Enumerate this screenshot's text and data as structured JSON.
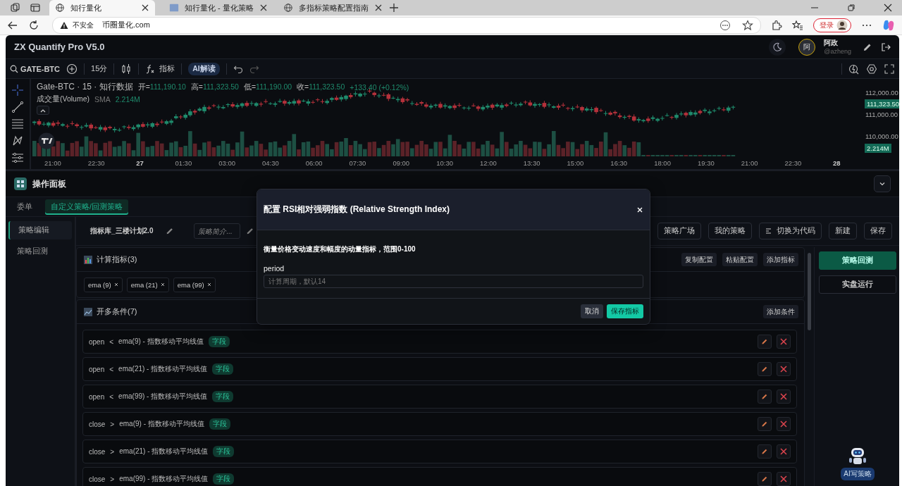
{
  "browser": {
    "tabs": [
      {
        "title": "知行量化",
        "selected": true
      },
      {
        "title": "知行量化 - 量化策略",
        "selected": false
      },
      {
        "title": "多指标策略配置指南",
        "selected": false
      }
    ],
    "security": "不安全",
    "url": "币圈量化.com",
    "login": "登录"
  },
  "app": {
    "title": "ZX Quantify Pro V5.0",
    "user": {
      "avatar": "阿",
      "name": "阿政",
      "handle": "@azheng"
    }
  },
  "toolbar": {
    "symbol": "GATE-BTC",
    "interval": "15分",
    "indicators": "指标",
    "ai": "AI解读"
  },
  "chart": {
    "legend": "Gate-BTC · 15 · 知行数据",
    "ohlc": [
      {
        "label": "开=",
        "value": "111,190.10"
      },
      {
        "label": "高=",
        "value": "111,323.50"
      },
      {
        "label": "低=",
        "value": "111,190.00"
      },
      {
        "label": "收=",
        "value": "111,323.50"
      }
    ],
    "change": "+133.40 (+0.12%)",
    "volume": {
      "label": "成交量(Volume)",
      "ma": "SMA",
      "value": "2.214M"
    },
    "price_axis": [
      "112,000.00",
      "111,000.00",
      "110,000.00"
    ],
    "last_price": "111,323.50",
    "last_volume": "2.214M",
    "time_axis": [
      {
        "label": "21:00",
        "bold": false
      },
      {
        "label": "22:30",
        "bold": false
      },
      {
        "label": "27",
        "bold": true
      },
      {
        "label": "01:30",
        "bold": false
      },
      {
        "label": "03:00",
        "bold": false
      },
      {
        "label": "04:30",
        "bold": false
      },
      {
        "label": "06:00",
        "bold": false
      },
      {
        "label": "07:30",
        "bold": false
      },
      {
        "label": "09:00",
        "bold": false
      },
      {
        "label": "10:30",
        "bold": false
      },
      {
        "label": "12:00",
        "bold": false
      },
      {
        "label": "13:30",
        "bold": false
      },
      {
        "label": "15:00",
        "bold": false
      },
      {
        "label": "16:30",
        "bold": false
      },
      {
        "label": "18:00",
        "bold": false
      },
      {
        "label": "19:30",
        "bold": false
      },
      {
        "label": "21:00",
        "bold": false
      },
      {
        "label": "22:30",
        "bold": false
      },
      {
        "label": "28",
        "bold": true
      }
    ]
  },
  "panel": {
    "title": "操作面板",
    "tabs": [
      {
        "label": "委单",
        "selected": false
      },
      {
        "label": "自定义策略/回测策略",
        "selected": true
      }
    ],
    "nav": [
      {
        "label": "策略编辑",
        "selected": true
      },
      {
        "label": "策略回测",
        "selected": false
      }
    ],
    "strategy_name": "指标库_三楼计划2.0",
    "summary_placeholder": "策略简介...",
    "actions": [
      {
        "label": "策略广场",
        "icon": false
      },
      {
        "label": "我的策略",
        "icon": false
      },
      {
        "label": "切换为代码",
        "icon": true
      },
      {
        "label": "新建",
        "icon": false
      },
      {
        "label": "保存",
        "icon": false
      }
    ],
    "indicators": {
      "title": "计算指标(3)",
      "buttons": [
        "复制配置",
        "粘贴配置",
        "添加指标"
      ],
      "chips": [
        "ema (9)",
        "ema (21)",
        "ema (99)"
      ]
    },
    "conditions": {
      "title": "开多条件(7)",
      "button": "添加条件",
      "rows": [
        {
          "field": "open",
          "op": "<",
          "expr": "ema(9) - 指数移动平均线值",
          "tag": "字段"
        },
        {
          "field": "open",
          "op": "<",
          "expr": "ema(21) - 指数移动平均线值",
          "tag": "字段"
        },
        {
          "field": "open",
          "op": "<",
          "expr": "ema(99) - 指数移动平均线值",
          "tag": "字段"
        },
        {
          "field": "close",
          "op": ">",
          "expr": "ema(9) - 指数移动平均线值",
          "tag": "字段"
        },
        {
          "field": "close",
          "op": ">",
          "expr": "ema(21) - 指数移动平均线值",
          "tag": "字段"
        },
        {
          "field": "close",
          "op": ">",
          "expr": "ema(99) - 指数移动平均线值",
          "tag": "字段"
        }
      ]
    },
    "side_buttons": [
      {
        "label": "策略回测",
        "primary": true
      },
      {
        "label": "实盘运行",
        "primary": false
      }
    ],
    "assistant": "AI写策略"
  },
  "modal": {
    "title": "配置 RSI相对强弱指数 (Relative Strength Index)",
    "description": "衡量价格变动速度和幅度的动量指标，范围0-100",
    "field_label": "period",
    "placeholder": "计算周期，默认14",
    "cancel": "取消",
    "confirm": "保存指标"
  }
}
